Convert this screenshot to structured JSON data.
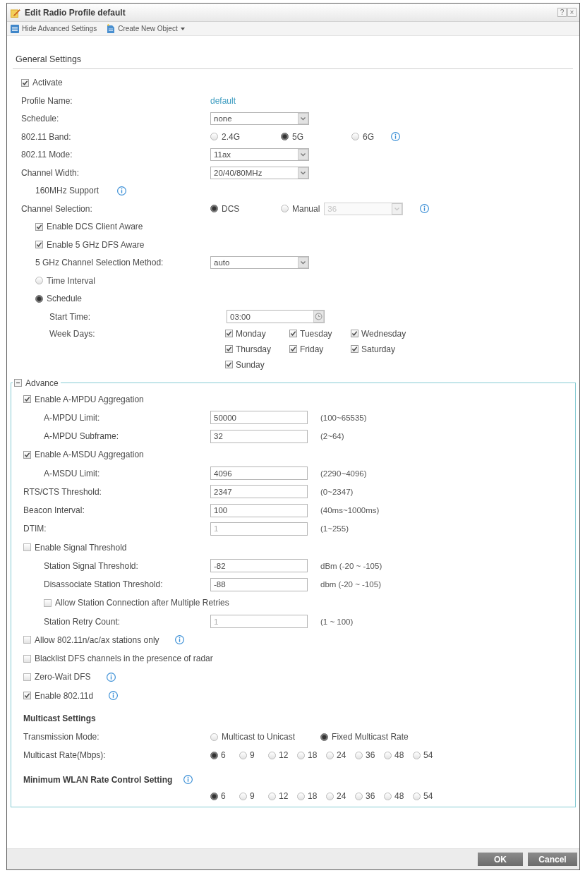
{
  "window": {
    "title": "Edit Radio Profile default",
    "help": "?",
    "close": "×"
  },
  "toolbar": [
    {
      "kind": "list",
      "label": "Hide Advanced Settings",
      "menu": false
    },
    {
      "kind": "new",
      "label": "Create New Object",
      "menu": true
    }
  ],
  "general": {
    "title": "General Settings",
    "rows": [
      {
        "kind": "checkbox",
        "label": "Activate",
        "checked": true
      },
      {
        "kind": "text",
        "label": "Profile Name:",
        "value": "default"
      },
      {
        "kind": "select",
        "label": "Schedule:",
        "value": "none"
      },
      {
        "kind": "radio",
        "label": "802.11 Band:",
        "info": true,
        "options": [
          {
            "label": "2.4G",
            "selected": false
          },
          {
            "label": "5G",
            "selected": true
          },
          {
            "label": "6G",
            "selected": false
          }
        ]
      },
      {
        "kind": "select",
        "label": "802.11 Mode:",
        "value": "11ax"
      },
      {
        "kind": "select",
        "label": "Channel Width:",
        "value": "20/40/80MHz",
        "children": [
          {
            "kind": "label",
            "label": "160MHz Support",
            "info": true
          }
        ]
      },
      {
        "kind": "radio",
        "label": "Channel Selection:",
        "info": true,
        "options": [
          {
            "label": "DCS",
            "selected": true
          },
          {
            "label": "Manual",
            "selected": false,
            "select": {
              "value": "36",
              "disabled": true
            }
          }
        ],
        "children": [
          {
            "kind": "checkbox",
            "label": "Enable DCS Client Aware",
            "checked": true
          },
          {
            "kind": "checkbox",
            "label": "Enable 5 GHz DFS Aware",
            "checked": true
          },
          {
            "kind": "select",
            "label": "5 GHz Channel Selection Method:",
            "value": "auto"
          },
          {
            "kind": "option",
            "label": "Time Interval",
            "selected": false
          },
          {
            "kind": "option",
            "label": "Schedule",
            "selected": true,
            "children": [
              {
                "kind": "time",
                "label": "Start Time:",
                "value": "03:00"
              },
              {
                "kind": "days",
                "label": "Week Days:",
                "days": [
                  {
                    "label": "Monday",
                    "checked": true
                  },
                  {
                    "label": "Tuesday",
                    "checked": true
                  },
                  {
                    "label": "Wednesday",
                    "checked": true
                  },
                  {
                    "label": "Thursday",
                    "checked": true
                  },
                  {
                    "label": "Friday",
                    "checked": true
                  },
                  {
                    "label": "Saturday",
                    "checked": true
                  },
                  {
                    "label": "Sunday",
                    "checked": true
                  }
                ]
              }
            ]
          }
        ]
      }
    ]
  },
  "advance": {
    "title": "Advance",
    "expanded": true,
    "rows": [
      {
        "kind": "checkbox",
        "label": "Enable A-MPDU Aggregation",
        "checked": true,
        "children": [
          {
            "kind": "field",
            "label": "A-MPDU Limit:",
            "value": "50000",
            "hint": "(100~65535)",
            "disabled": false
          },
          {
            "kind": "field",
            "label": "A-MPDU Subframe:",
            "value": "32",
            "hint": "(2~64)",
            "disabled": false
          }
        ]
      },
      {
        "kind": "checkbox",
        "label": "Enable A-MSDU Aggregation",
        "checked": true,
        "children": [
          {
            "kind": "field",
            "label": "A-MSDU Limit:",
            "value": "4096",
            "hint": "(2290~4096)",
            "disabled": false
          }
        ]
      },
      {
        "kind": "field",
        "label": "RTS/CTS Threshold:",
        "value": "2347",
        "hint": "(0~2347)",
        "disabled": false
      },
      {
        "kind": "field",
        "label": "Beacon Interval:",
        "value": "100",
        "hint": "(40ms~1000ms)",
        "disabled": false
      },
      {
        "kind": "field",
        "label": "DTIM:",
        "value": "1",
        "hint": "(1~255)",
        "disabled": true
      },
      {
        "kind": "checkbox",
        "label": "Enable Signal Threshold",
        "checked": false,
        "children": [
          {
            "kind": "field",
            "label": "Station Signal Threshold:",
            "value": "-82",
            "hint": "dBm (-20 ~ -105)",
            "disabled": false
          },
          {
            "kind": "field",
            "label": "Disassociate Station Threshold:",
            "value": "-88",
            "hint": "dbm (-20 ~ -105)",
            "disabled": false
          },
          {
            "kind": "checkbox",
            "label": "Allow Station Connection after Multiple Retries",
            "checked": false
          },
          {
            "kind": "field",
            "label": "Station Retry Count:",
            "value": "1",
            "hint": "(1 ~ 100)",
            "disabled": true
          }
        ]
      },
      {
        "kind": "checkbox",
        "label": "Allow 802.11n/ac/ax stations only",
        "checked": false,
        "info": true
      },
      {
        "kind": "checkbox",
        "label": "Blacklist DFS channels in the presence of radar",
        "checked": false
      },
      {
        "kind": "checkbox",
        "label": "Zero-Wait DFS",
        "checked": false,
        "info": true
      },
      {
        "kind": "checkbox",
        "label": "Enable 802.11d",
        "checked": true,
        "info": true
      },
      {
        "kind": "heading",
        "label": "Multicast Settings"
      },
      {
        "kind": "radio",
        "label": "Transmission Mode:",
        "options": [
          {
            "label": "Multicast to Unicast",
            "selected": false
          },
          {
            "label": "Fixed Multicast Rate",
            "selected": true
          }
        ]
      },
      {
        "kind": "radio",
        "label": "Multicast Rate(Mbps):",
        "options": [
          {
            "label": "6",
            "selected": true
          },
          {
            "label": "9",
            "selected": false
          },
          {
            "label": "12",
            "selected": false
          },
          {
            "label": "18",
            "selected": false
          },
          {
            "label": "24",
            "selected": false
          },
          {
            "label": "36",
            "selected": false
          },
          {
            "label": "48",
            "selected": false
          },
          {
            "label": "54",
            "selected": false
          }
        ]
      },
      {
        "kind": "heading",
        "label": "Minimum WLAN Rate Control Setting",
        "info": true,
        "options": [
          {
            "label": "6",
            "selected": true
          },
          {
            "label": "9",
            "selected": false
          },
          {
            "label": "12",
            "selected": false
          },
          {
            "label": "18",
            "selected": false
          },
          {
            "label": "24",
            "selected": false
          },
          {
            "label": "36",
            "selected": false
          },
          {
            "label": "48",
            "selected": false
          },
          {
            "label": "54",
            "selected": false
          }
        ]
      }
    ]
  },
  "buttons": [
    "OK",
    "Cancel"
  ]
}
